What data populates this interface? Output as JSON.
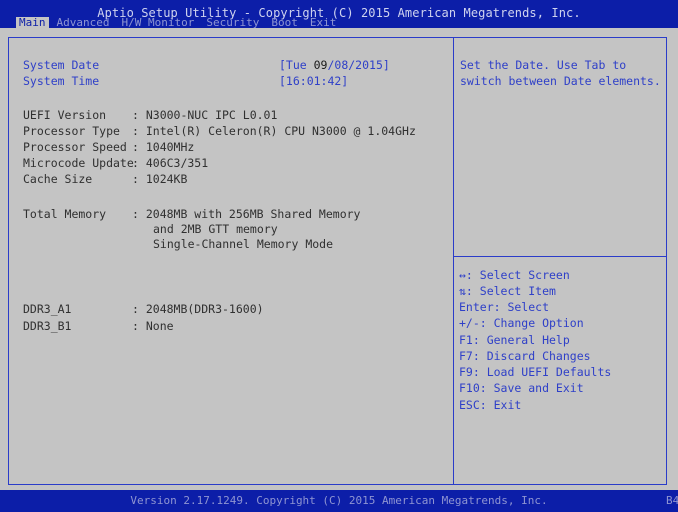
{
  "header": {
    "title": "Aptio Setup Utility - Copyright (C) 2015 American Megatrends, Inc.",
    "tabs": [
      "Main",
      "Advanced",
      "H/W Monitor",
      "Security",
      "Boot",
      "Exit"
    ],
    "active_tab": "Main"
  },
  "main": {
    "system_date": {
      "label": "System Date",
      "value_prefix": "[Tue ",
      "cursor": "09",
      "value_suffix": "/08/2015]"
    },
    "system_time": {
      "label": "System Time",
      "value": "[16:01:42]"
    },
    "uefi_version": {
      "label": "UEFI Version",
      "value": ": N3000-NUC IPC L0.01"
    },
    "processor_type": {
      "label": "Processor Type",
      "value": ": Intel(R) Celeron(R) CPU N3000 @ 1.04GHz"
    },
    "processor_speed": {
      "label": "Processor Speed",
      "value": ": 1040MHz"
    },
    "microcode_update": {
      "label": "Microcode Update",
      "value": ": 406C3/351"
    },
    "cache_size": {
      "label": "Cache Size",
      "value": ": 1024KB"
    },
    "total_memory": {
      "label": "Total Memory",
      "lines": [
        ": 2048MB with 256MB Shared Memory",
        "and 2MB GTT memory",
        "Single-Channel Memory Mode"
      ]
    },
    "ddr3_a1": {
      "label": "DDR3_A1",
      "value": ": 2048MB(DDR3-1600)"
    },
    "ddr3_b1": {
      "label": "DDR3_B1",
      "value": ": None"
    }
  },
  "help": {
    "description_lines": [
      "Set the Date. Use Tab to",
      "switch between Date elements."
    ],
    "keys": [
      "↔: Select Screen",
      "⇅: Select Item",
      "Enter: Select",
      "+/-: Change Option",
      "F1: General Help",
      "F7: Discard Changes",
      "F9: Load UEFI Defaults",
      "F10: Save and Exit",
      "ESC: Exit"
    ]
  },
  "footer": {
    "text": "Version 2.17.1249. Copyright (C) 2015 American Megatrends, Inc.",
    "corner": "B4"
  },
  "colors": {
    "background": "#c4c4c4",
    "bar": "#0c1ea8",
    "accent_text": "#2f40c8"
  }
}
